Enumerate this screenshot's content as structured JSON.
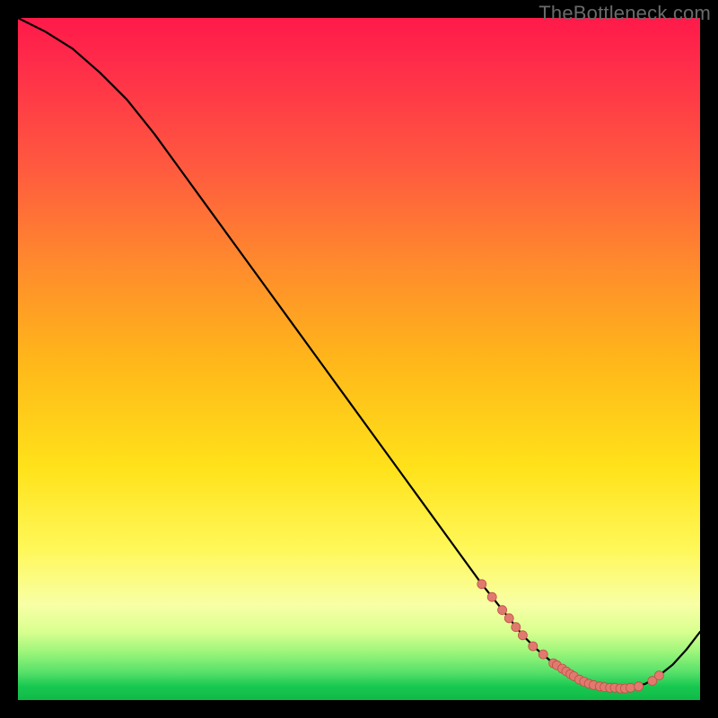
{
  "watermark": "TheBottleneck.com",
  "colors": {
    "curve": "#000000",
    "marker_fill": "#e07a6e",
    "marker_stroke": "#c05048"
  },
  "chart_data": {
    "type": "line",
    "title": "",
    "xlabel": "",
    "ylabel": "",
    "xlim": [
      0,
      100
    ],
    "ylim": [
      0,
      100
    ],
    "grid": false,
    "series": [
      {
        "name": "curve",
        "x": [
          0,
          4,
          8,
          12,
          16,
          20,
          24,
          28,
          32,
          36,
          40,
          44,
          48,
          52,
          56,
          60,
          64,
          68,
          72,
          74,
          76,
          78,
          80,
          82,
          84,
          86,
          88,
          90,
          92,
          94,
          96,
          98,
          100
        ],
        "y": [
          100,
          98,
          95.5,
          92,
          88,
          83,
          77.5,
          72,
          66.5,
          61,
          55.5,
          50,
          44.5,
          39,
          33.5,
          28,
          22.5,
          17,
          12,
          9.5,
          7.5,
          5.8,
          4.4,
          3.2,
          2.4,
          1.9,
          1.7,
          1.8,
          2.4,
          3.6,
          5.2,
          7.4,
          10
        ]
      }
    ],
    "markers": [
      {
        "x": 68,
        "y": 17
      },
      {
        "x": 69.5,
        "y": 15.1
      },
      {
        "x": 71,
        "y": 13.2
      },
      {
        "x": 72,
        "y": 12
      },
      {
        "x": 73,
        "y": 10.7
      },
      {
        "x": 74,
        "y": 9.5
      },
      {
        "x": 75.5,
        "y": 7.9
      },
      {
        "x": 77,
        "y": 6.7
      },
      {
        "x": 78.5,
        "y": 5.4
      },
      {
        "x": 79,
        "y": 5.1
      },
      {
        "x": 79.8,
        "y": 4.6
      },
      {
        "x": 80.4,
        "y": 4.2
      },
      {
        "x": 81,
        "y": 3.8
      },
      {
        "x": 81.5,
        "y": 3.5
      },
      {
        "x": 82.3,
        "y": 3.0
      },
      {
        "x": 83,
        "y": 2.7
      },
      {
        "x": 83.7,
        "y": 2.4
      },
      {
        "x": 84.4,
        "y": 2.2
      },
      {
        "x": 85.3,
        "y": 2.0
      },
      {
        "x": 86,
        "y": 1.9
      },
      {
        "x": 86.8,
        "y": 1.8
      },
      {
        "x": 87.5,
        "y": 1.8
      },
      {
        "x": 88.3,
        "y": 1.7
      },
      {
        "x": 89,
        "y": 1.7
      },
      {
        "x": 89.8,
        "y": 1.8
      },
      {
        "x": 91,
        "y": 2.0
      },
      {
        "x": 93,
        "y": 2.8
      },
      {
        "x": 94,
        "y": 3.6
      }
    ]
  }
}
